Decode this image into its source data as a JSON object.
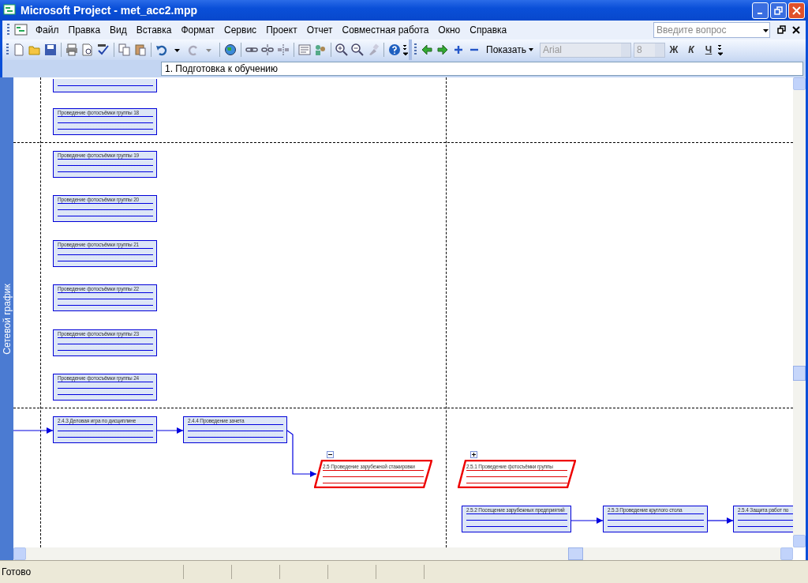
{
  "window": {
    "title": "Microsoft Project - met_acc2.mpp"
  },
  "menu": [
    "Файл",
    "Правка",
    "Вид",
    "Вставка",
    "Формат",
    "Сервис",
    "Проект",
    "Отчет",
    "Совместная работа",
    "Окно",
    "Справка"
  ],
  "help_search": {
    "placeholder": "Введите вопрос"
  },
  "formatting": {
    "show_button": "Показать",
    "font": "Arial",
    "size": "8",
    "style_buttons": [
      "Ж",
      "К",
      "Ч"
    ]
  },
  "entry_bar": {
    "value": "1. Подготовка к обучению"
  },
  "view_bar": {
    "label": "Сетевой график"
  },
  "network": {
    "column_nodes": [
      {
        "cut": true
      },
      {
        "cut": false,
        "title": "Проведение фотосъёмки группы 18"
      },
      {
        "cut": false,
        "title": "Проведение фотосъёмки группы 19"
      },
      {
        "cut": false,
        "title": "Проведение фотосъёмки группы 20"
      },
      {
        "cut": false,
        "title": "Проведение фотосъёмки группы 21"
      },
      {
        "cut": false,
        "title": "Проведение фотосъёмки группы 22"
      },
      {
        "cut": false,
        "title": "Проведение фотосъёмки группы 23"
      },
      {
        "cut": false,
        "title": "Проведение фотосъёмки группы 24"
      }
    ],
    "chain_nodes": [
      {
        "title": "2.4.3 Деловая игра по дисциплине"
      },
      {
        "title": "2.4.4 Проведение зачета"
      }
    ],
    "summary_nodes": [
      {
        "expanded": true,
        "title": "2.5 Проведение зарубежной стажировки"
      },
      {
        "expanded": false,
        "title": "2.5.1 Проведение фотосъёмки группы"
      }
    ],
    "lower_nodes": [
      {
        "title": "2.5.2 Посещение зарубежных предприятий"
      },
      {
        "title": "2.5.3 Проведение круглого стола"
      },
      {
        "title": "2.5.4 Защита работ по"
      }
    ]
  },
  "status_bar": {
    "text": "Готово"
  }
}
